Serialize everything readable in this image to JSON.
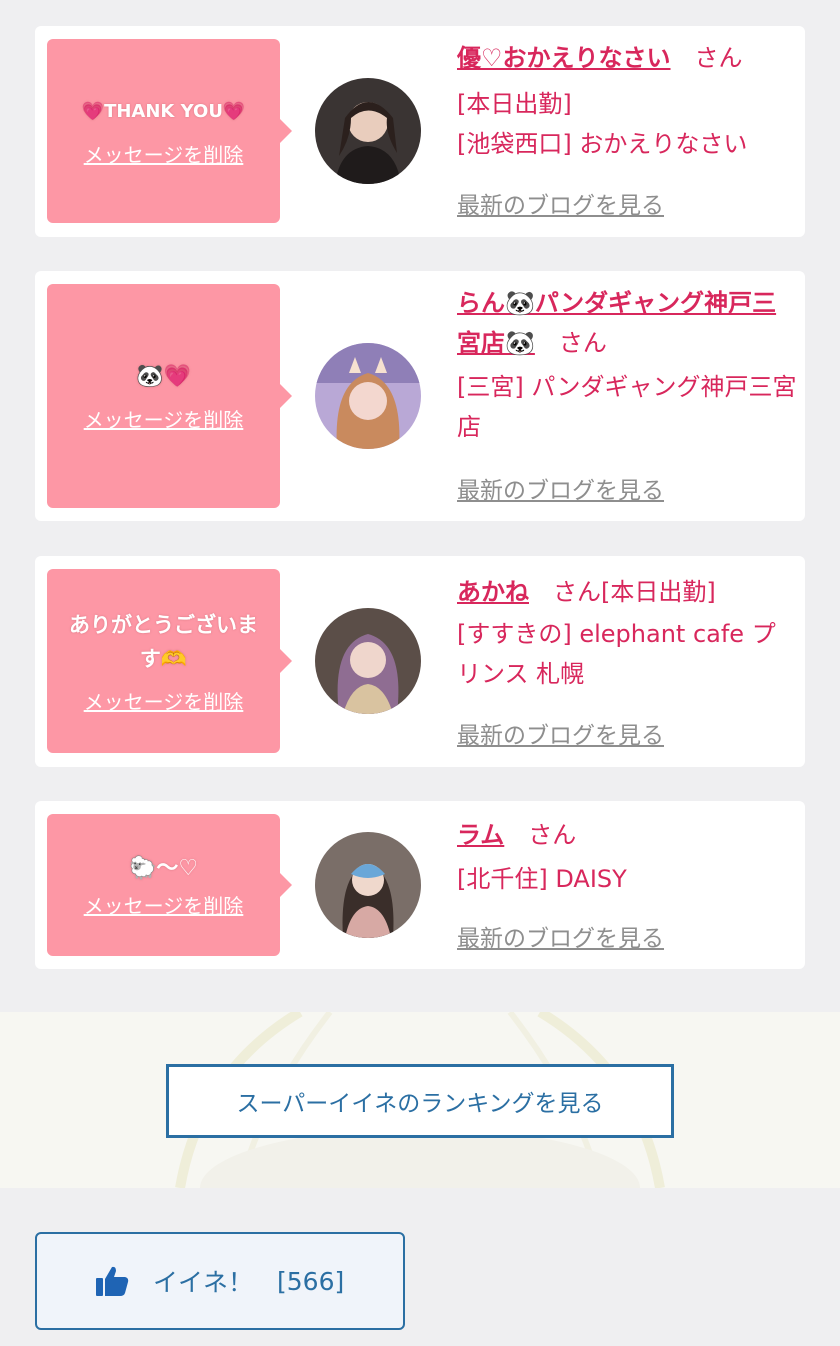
{
  "cards": [
    {
      "message": "💗THANK YOU💗",
      "delete_label": "メッセージを削除",
      "name": "優♡おかえりなさい",
      "honorific": "さん",
      "lines": [
        "[本日出勤]",
        "[池袋西口] おかえりなさい"
      ],
      "blog_label": "最新のブログを見る"
    },
    {
      "message": "🐼💗",
      "delete_label": "メッセージを削除",
      "name": "らん🐼パンダギャング神戸三宮店🐼",
      "honorific": "さん",
      "lines": [
        "[三宮] パンダギャング神戸三宮店"
      ],
      "blog_label": "最新のブログを見る"
    },
    {
      "message": "ありがとうございます🫶",
      "delete_label": "メッセージを削除",
      "name": "あかね",
      "honorific": "さん",
      "lines": [
        "[本日出勤]",
        "[すすきの] elephant cafe プリンス 札幌"
      ],
      "blog_label": "最新のブログを見る"
    },
    {
      "message": "🐑〜♡",
      "delete_label": "メッセージを削除",
      "name": "ラム",
      "honorific": "さん",
      "lines": [
        "[北千住] DAISY"
      ],
      "blog_label": "最新のブログを見る"
    }
  ],
  "ranking_button": "スーパーイイネのランキングを見る",
  "like_button": {
    "icon": "thumbs-up-icon",
    "label": "イイネ！",
    "count": "[566]"
  },
  "colors": {
    "bubble": "#fd97a5",
    "name": "#d8275c",
    "link_gray": "#8e8e8e",
    "accent_blue": "#2b6fa3"
  }
}
